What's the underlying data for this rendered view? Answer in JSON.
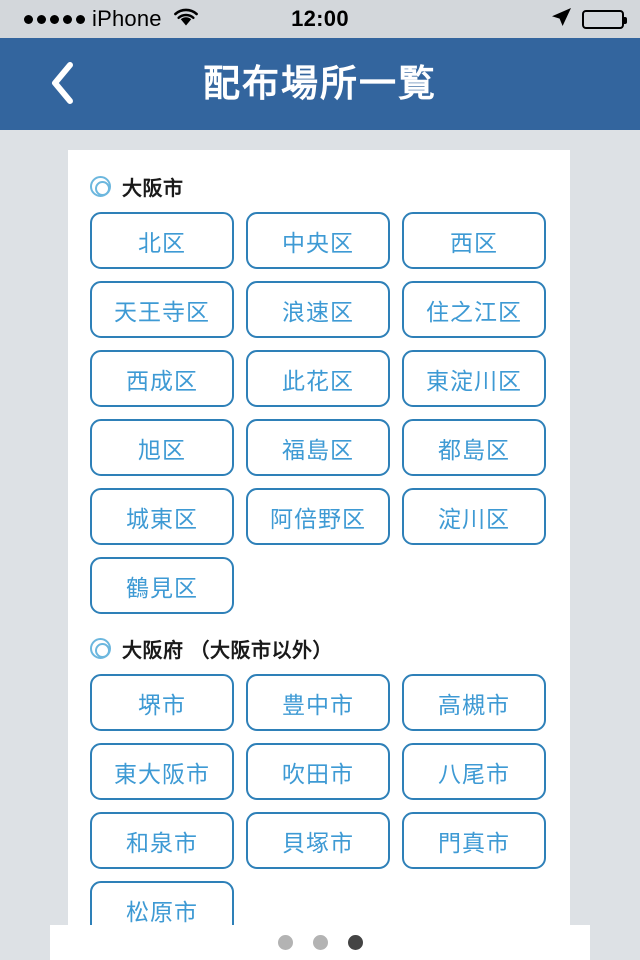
{
  "status_bar": {
    "signal_dots": 5,
    "carrier": "iPhone",
    "wifi_icon": "wifi-icon",
    "time": "12:00",
    "location_icon": "location-arrow-icon",
    "battery_icon": "battery-full-icon"
  },
  "nav_bar": {
    "back_icon": "chevron-left-icon",
    "title": "配布場所一覧",
    "background_color": "#33659e"
  },
  "sections": [
    {
      "bullet_icon": "double-circle-icon",
      "title": "大阪市",
      "buttons": [
        "北区",
        "中央区",
        "西区",
        "天王寺区",
        "浪速区",
        "住之江区",
        "西成区",
        "此花区",
        "東淀川区",
        "旭区",
        "福島区",
        "都島区",
        "城東区",
        "阿倍野区",
        "淀川区",
        "鶴見区"
      ]
    },
    {
      "bullet_icon": "double-circle-icon",
      "title": "大阪府 （大阪市以外）",
      "buttons": [
        "堺市",
        "豊中市",
        "高槻市",
        "東大阪市",
        "吹田市",
        "八尾市",
        "和泉市",
        "貝塚市",
        "門真市",
        "松原市"
      ]
    }
  ],
  "pager": {
    "total": 3,
    "active_index": 2
  },
  "colors": {
    "nav_background": "#33659e",
    "button_border": "#2e80b8",
    "button_text": "#3e9ad4",
    "page_background": "#dde1e5",
    "card_background": "#ffffff",
    "dot_inactive": "#b3b3b3",
    "dot_active": "#444444"
  }
}
